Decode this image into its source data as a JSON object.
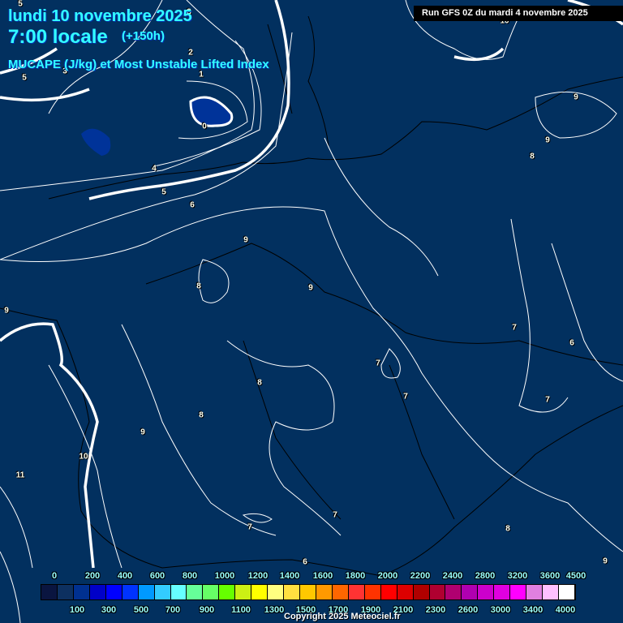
{
  "header": {
    "date": "lundi 10 novembre 2025",
    "time": "7:00 locale",
    "lead": "(+150h)",
    "parameter": "MUCAPE (J/kg) et Most Unstable Lifted Index"
  },
  "run_info": "Run GFS 0Z du mardi 4 novembre 2025",
  "copyright": "Copyright 2025 Meteociel.fr",
  "colors": {
    "background": "#02305f",
    "contour": "#ffffff",
    "coast": "#000000"
  },
  "colorbar": {
    "swatches": [
      "#0a1540",
      "#0d3060",
      "#003090",
      "#0000c8",
      "#0000ff",
      "#0033ff",
      "#0099ff",
      "#33ccff",
      "#66ffff",
      "#66ff99",
      "#66ff66",
      "#66ff00",
      "#ccf014",
      "#ffff00",
      "#ffff80",
      "#ffe040",
      "#ffc800",
      "#ff9900",
      "#ff6600",
      "#ff3333",
      "#ff3300",
      "#ff0000",
      "#dd0000",
      "#b00000",
      "#b00030",
      "#b00070",
      "#b000b0",
      "#cc00cc",
      "#e000e0",
      "#ff00ff",
      "#e080e0",
      "#ffc0ff",
      "#ffffff"
    ],
    "top_labels": [
      "0",
      "200",
      "400",
      "600",
      "800",
      "1000",
      "1200",
      "1400",
      "1600",
      "1800",
      "2000",
      "2200",
      "2400",
      "2800",
      "3200",
      "3600",
      "4500"
    ],
    "bottom_labels": [
      "100",
      "300",
      "500",
      "700",
      "900",
      "1100",
      "1300",
      "1500",
      "1700",
      "1900",
      "2100",
      "2300",
      "2600",
      "3000",
      "3400",
      "4000"
    ]
  },
  "contour_labels": [
    "5",
    "3",
    "3",
    "5",
    "2",
    "1",
    "0",
    "4",
    "5",
    "6",
    "9",
    "8",
    "9",
    "9",
    "7",
    "6",
    "7",
    "7",
    "7",
    "8",
    "8",
    "9",
    "10",
    "11",
    "7",
    "7",
    "8",
    "6",
    "9",
    "9",
    "8",
    "10",
    "9"
  ]
}
